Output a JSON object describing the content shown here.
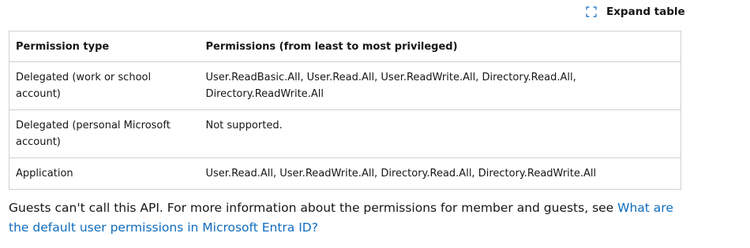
{
  "toolbar": {
    "expand_label": "Expand table",
    "expand_icon": "expand-icon"
  },
  "table": {
    "headers": [
      "Permission type",
      "Permissions (from least to most privileged)"
    ],
    "rows": [
      {
        "type": "Delegated (work or school account)",
        "permissions": "User.ReadBasic.All, User.Read.All, User.ReadWrite.All, Directory.Read.All, Directory.ReadWrite.All"
      },
      {
        "type": "Delegated (personal Microsoft account)",
        "permissions": "Not supported."
      },
      {
        "type": "Application",
        "permissions": "User.Read.All, User.ReadWrite.All, Directory.Read.All, Directory.ReadWrite.All"
      }
    ]
  },
  "note": {
    "text": "Guests can't call this API. For more information about the permissions for member and guests, see ",
    "link_text": "What are the default user permissions in Microsoft Entra ID?"
  },
  "colors": {
    "link": "#0f6cbd",
    "border": "#d1d1d1",
    "text": "#161616"
  }
}
